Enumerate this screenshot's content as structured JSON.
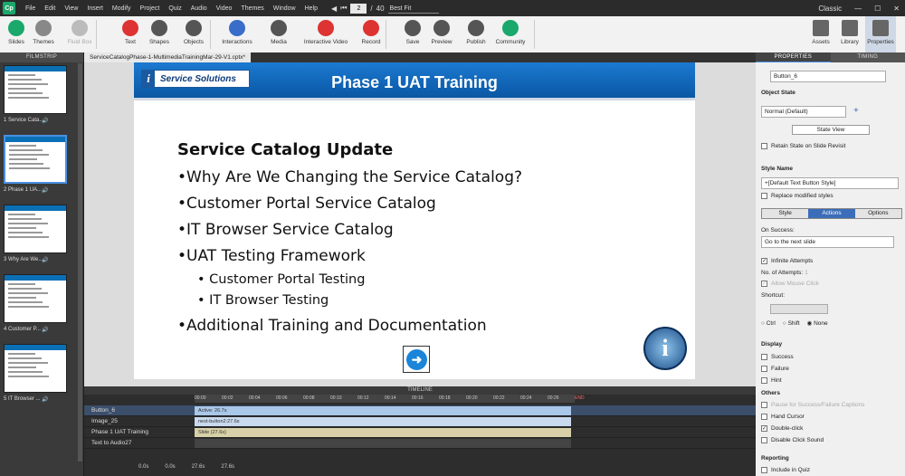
{
  "menubar": {
    "items": [
      "File",
      "Edit",
      "View",
      "Insert",
      "Modify",
      "Project",
      "Quiz",
      "Audio",
      "Video",
      "Themes",
      "Window",
      "Help"
    ],
    "page_current": "2",
    "page_total": "40",
    "zoom": "Best Fit",
    "workspace": "Classic"
  },
  "toolbar": {
    "buttons": [
      {
        "label": "Slides",
        "icon": "slides-icon",
        "color": "#1aa86b"
      },
      {
        "label": "Themes",
        "icon": "themes-icon",
        "color": "#888"
      },
      {
        "label": "Fluid Box",
        "icon": "fluid-box-icon",
        "color": "#bbb"
      },
      {
        "label": "Text",
        "icon": "text-icon",
        "color": "#d33"
      },
      {
        "label": "Shapes",
        "icon": "shapes-icon",
        "color": "#555"
      },
      {
        "label": "Objects",
        "icon": "objects-icon",
        "color": "#555"
      },
      {
        "label": "Interactions",
        "icon": "interactions-icon",
        "color": "#3a6cc9"
      },
      {
        "label": "Media",
        "icon": "media-icon",
        "color": "#555"
      },
      {
        "label": "Interactive Video",
        "icon": "interactive-video-icon",
        "color": "#d33"
      },
      {
        "label": "Record",
        "icon": "record-icon",
        "color": "#d33"
      },
      {
        "label": "Save",
        "icon": "save-icon",
        "color": "#555"
      },
      {
        "label": "Preview",
        "icon": "preview-icon",
        "color": "#555"
      },
      {
        "label": "Publish",
        "icon": "publish-icon",
        "color": "#555"
      },
      {
        "label": "Community",
        "icon": "community-icon",
        "color": "#1aa86b"
      }
    ],
    "right_buttons": [
      {
        "label": "Assets",
        "icon": "assets-icon"
      },
      {
        "label": "Library",
        "icon": "library-icon"
      },
      {
        "label": "Properties",
        "icon": "properties-icon"
      }
    ]
  },
  "filmstrip": {
    "header": "FILMSTRIP",
    "slides": [
      {
        "label": "1 Service Cata..."
      },
      {
        "label": "2 Phase 1 UA..."
      },
      {
        "label": "3 Why Are We..."
      },
      {
        "label": "4 Customer P..."
      },
      {
        "label": "5 IT Browser ..."
      }
    ],
    "thumb1_text": [
      "Service Catalog Update",
      "Phase 1 – New and Retired Services",
      "Service Solutions UAT Training",
      "March 2022"
    ]
  },
  "document_tab": "ServiceCatalogPhase-1-MultimediaTrainingMar-29-V1.cptx*",
  "slide": {
    "logo_i": "i",
    "logo_text": "Service Solutions",
    "title": "Phase 1 UAT Training",
    "heading": "Service Catalog Update",
    "bullets": [
      "•Why Are We Changing the Service Catalog?",
      "•Customer Portal Service Catalog",
      "•IT Browser Service Catalog",
      "•UAT Testing Framework"
    ],
    "sub_bullets": [
      "• Customer Portal Testing",
      "• IT Browser Testing"
    ],
    "last_bullet": "•Additional Training and Documentation",
    "seal_letter": "i"
  },
  "timeline": {
    "header": "TIMELINE",
    "ticks": [
      "00:00",
      "00:02",
      "00:04",
      "00:06",
      "00:08",
      "00:10",
      "00:12",
      "00:14",
      "00:16",
      "00:18",
      "00:20",
      "00:22",
      "00:24",
      "00:26"
    ],
    "end_label": "END",
    "rows": [
      {
        "name": "Button_6",
        "bar": "Active: 26.7s",
        "color": "#a9c7e8"
      },
      {
        "name": "Image_25",
        "bar": "next-button2:27.6s",
        "color": "#c9d9ee"
      },
      {
        "name": "Phase 1 UAT Training",
        "bar": "Slide (27.6s)",
        "color": "#d8d0a8"
      },
      {
        "name": "Text to Audio27",
        "bar": "",
        "color": "#444"
      }
    ],
    "footer": [
      "0.0s",
      "0.0s",
      "27.6s",
      "27.6s"
    ]
  },
  "properties": {
    "tabs": [
      "PROPERTIES",
      "TIMING"
    ],
    "object_name": "Button_6",
    "object_state_label": "Object State",
    "state_value": "Normal (Default)",
    "state_view_button": "State View",
    "retain_state": "Retain State on Slide Revisit",
    "style_name_label": "Style Name",
    "style_value": "+[Default Text Button Style]",
    "replace_styles": "Replace modified styles",
    "subtabs": [
      "Style",
      "Actions",
      "Options"
    ],
    "on_success_label": "On Success:",
    "on_success_value": "Go to the next slide",
    "infinite_attempts": "Infinite Attempts",
    "attempts_label": "No. of Attempts:",
    "attempts_value": "1",
    "allow_mouse": "Allow Mouse Click",
    "shortcut_label": "Shortcut:",
    "modifiers": [
      "Ctrl",
      "Shift",
      "None"
    ],
    "display_label": "Display",
    "display_items": [
      "Success",
      "Failure",
      "Hint"
    ],
    "others_label": "Others",
    "others_items": [
      {
        "label": "Pause for Success/Failure Captions",
        "checked": false,
        "dim": true
      },
      {
        "label": "Hand Cursor",
        "checked": false,
        "dim": false
      },
      {
        "label": "Double-click",
        "checked": true,
        "dim": false
      },
      {
        "label": "Disable Click Sound",
        "checked": false,
        "dim": false
      }
    ],
    "reporting_label": "Reporting",
    "include_quiz": "Include in Quiz"
  }
}
